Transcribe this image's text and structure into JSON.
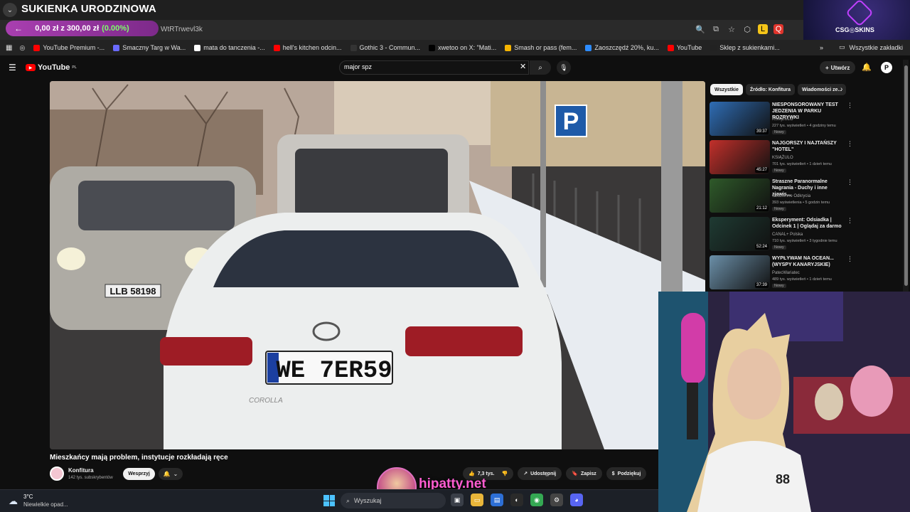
{
  "stream": {
    "title": "SUKIENKA URODZINOWA",
    "donation_left_icon": "arrow-left-icon",
    "donation_progress": "0,00 zł z 300,00 zł",
    "donation_percent": "(0.00%)",
    "donation_fraction": 0.0,
    "watermark": "hipatty.net"
  },
  "browser": {
    "url_fragment": "WtRTrwevl3k",
    "csgo_label": "CSG◎SKINS",
    "bookmarks": [
      {
        "label": "YouTube Premium -...",
        "color": "#ff0000"
      },
      {
        "label": "Smaczny Targ w Wa...",
        "color": "#6a6aff"
      },
      {
        "label": "mata do tanczenia -...",
        "color": "#ffffff"
      },
      {
        "label": "hell's kitchen odcin...",
        "color": "#ff0000"
      },
      {
        "label": "Gothic 3 - Commun...",
        "color": "#333333"
      },
      {
        "label": "xwetoo on X: \"Mati...",
        "color": "#000000"
      },
      {
        "label": "Smash or pass (fem...",
        "color": "#f5b400"
      },
      {
        "label": "Zaoszczędź 20%, ku...",
        "color": "#2d8cff"
      },
      {
        "label": "YouTube",
        "color": "#ff0000"
      },
      {
        "label": "Sklep z sukienkami...",
        "color": "#222222"
      }
    ],
    "all_bookmarks": "Wszystkie zakładki"
  },
  "youtube": {
    "logo": "YouTube",
    "logo_region": "PL",
    "search_value": "major spz",
    "create_label": "Utwórz",
    "avatar_letter": "P",
    "video": {
      "title": "Mieszkańcy mają problem, instytucje rozkładają ręce",
      "channel": "Konfitura",
      "subscribers": "142 tys. subskrybentów",
      "support_label": "Wesprzyj",
      "likes": "7,3 tys.",
      "share_label": "Udostępnij",
      "save_label": "Zapisz",
      "thanks_label": "Podziękuj",
      "plate_main": "WE 7ER59",
      "plate_side": "LLB 58198",
      "model_badge": "COROLLA",
      "p_sign": "P"
    },
    "chips": [
      "Wszystkie",
      "Źródło: Konfitura",
      "Wiadomości ze..."
    ],
    "recommendations": [
      {
        "title": "NIESPONSOROWANY TEST JEDZENIA W PARKU ROZRYWKI",
        "channel": "KSIĄŻULO",
        "meta": "227 tys. wyświetleń • 4 godziny temu",
        "badge": "Nowy",
        "duration": "39:37",
        "thumb": "#2f6db5"
      },
      {
        "title": "NAJGORSZY I NAJTAŃSZY \"HOTEL\"",
        "channel": "KSIĄŻULO",
        "meta": "701 tys. wyświetleń • 1 dzień temu",
        "badge": "Nowy",
        "duration": "45:27",
        "thumb": "#c2302b"
      },
      {
        "title": "Straszne Paranormalne Nagrania - Duchy i inne zjawis...",
        "channel": "Codzienne Odkrycia",
        "meta": "393 wyświetlenia • 5 godzin temu",
        "badge": "Nowy",
        "duration": "21:12",
        "thumb": "#2f5a2a"
      },
      {
        "title": "Eksperyment: Odsiadka | Odcinek 1 | Oglądaj za darmo",
        "channel": "CANAL+ Polska",
        "meta": "710 tys. wyświetleń • 3 tygodnie temu",
        "badge": "Nowy",
        "duration": "52:24",
        "thumb": "#1f3b33"
      },
      {
        "title": "WYPŁYWAM NA OCEAN... (WYSPY KANARYJSKIE)",
        "channel": "PatecWariatec",
        "meta": "489 tys. wyświetleń • 1 dzień temu",
        "badge": "Nowy",
        "duration": "37:39",
        "thumb": "#6b8fa8"
      }
    ]
  },
  "taskbar": {
    "temperature": "3°C",
    "weather": "Niewielkie opad...",
    "search_placeholder": "Wyszukaj"
  }
}
